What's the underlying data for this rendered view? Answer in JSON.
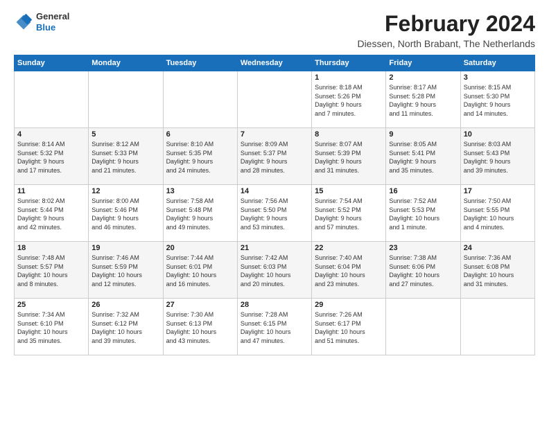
{
  "header": {
    "logo_general": "General",
    "logo_blue": "Blue",
    "month_title": "February 2024",
    "location": "Diessen, North Brabant, The Netherlands"
  },
  "days_of_week": [
    "Sunday",
    "Monday",
    "Tuesday",
    "Wednesday",
    "Thursday",
    "Friday",
    "Saturday"
  ],
  "weeks": [
    [
      {
        "day": "",
        "info": ""
      },
      {
        "day": "",
        "info": ""
      },
      {
        "day": "",
        "info": ""
      },
      {
        "day": "",
        "info": ""
      },
      {
        "day": "1",
        "info": "Sunrise: 8:18 AM\nSunset: 5:26 PM\nDaylight: 9 hours\nand 7 minutes."
      },
      {
        "day": "2",
        "info": "Sunrise: 8:17 AM\nSunset: 5:28 PM\nDaylight: 9 hours\nand 11 minutes."
      },
      {
        "day": "3",
        "info": "Sunrise: 8:15 AM\nSunset: 5:30 PM\nDaylight: 9 hours\nand 14 minutes."
      }
    ],
    [
      {
        "day": "4",
        "info": "Sunrise: 8:14 AM\nSunset: 5:32 PM\nDaylight: 9 hours\nand 17 minutes."
      },
      {
        "day": "5",
        "info": "Sunrise: 8:12 AM\nSunset: 5:33 PM\nDaylight: 9 hours\nand 21 minutes."
      },
      {
        "day": "6",
        "info": "Sunrise: 8:10 AM\nSunset: 5:35 PM\nDaylight: 9 hours\nand 24 minutes."
      },
      {
        "day": "7",
        "info": "Sunrise: 8:09 AM\nSunset: 5:37 PM\nDaylight: 9 hours\nand 28 minutes."
      },
      {
        "day": "8",
        "info": "Sunrise: 8:07 AM\nSunset: 5:39 PM\nDaylight: 9 hours\nand 31 minutes."
      },
      {
        "day": "9",
        "info": "Sunrise: 8:05 AM\nSunset: 5:41 PM\nDaylight: 9 hours\nand 35 minutes."
      },
      {
        "day": "10",
        "info": "Sunrise: 8:03 AM\nSunset: 5:43 PM\nDaylight: 9 hours\nand 39 minutes."
      }
    ],
    [
      {
        "day": "11",
        "info": "Sunrise: 8:02 AM\nSunset: 5:44 PM\nDaylight: 9 hours\nand 42 minutes."
      },
      {
        "day": "12",
        "info": "Sunrise: 8:00 AM\nSunset: 5:46 PM\nDaylight: 9 hours\nand 46 minutes."
      },
      {
        "day": "13",
        "info": "Sunrise: 7:58 AM\nSunset: 5:48 PM\nDaylight: 9 hours\nand 49 minutes."
      },
      {
        "day": "14",
        "info": "Sunrise: 7:56 AM\nSunset: 5:50 PM\nDaylight: 9 hours\nand 53 minutes."
      },
      {
        "day": "15",
        "info": "Sunrise: 7:54 AM\nSunset: 5:52 PM\nDaylight: 9 hours\nand 57 minutes."
      },
      {
        "day": "16",
        "info": "Sunrise: 7:52 AM\nSunset: 5:53 PM\nDaylight: 10 hours\nand 1 minute."
      },
      {
        "day": "17",
        "info": "Sunrise: 7:50 AM\nSunset: 5:55 PM\nDaylight: 10 hours\nand 4 minutes."
      }
    ],
    [
      {
        "day": "18",
        "info": "Sunrise: 7:48 AM\nSunset: 5:57 PM\nDaylight: 10 hours\nand 8 minutes."
      },
      {
        "day": "19",
        "info": "Sunrise: 7:46 AM\nSunset: 5:59 PM\nDaylight: 10 hours\nand 12 minutes."
      },
      {
        "day": "20",
        "info": "Sunrise: 7:44 AM\nSunset: 6:01 PM\nDaylight: 10 hours\nand 16 minutes."
      },
      {
        "day": "21",
        "info": "Sunrise: 7:42 AM\nSunset: 6:03 PM\nDaylight: 10 hours\nand 20 minutes."
      },
      {
        "day": "22",
        "info": "Sunrise: 7:40 AM\nSunset: 6:04 PM\nDaylight: 10 hours\nand 23 minutes."
      },
      {
        "day": "23",
        "info": "Sunrise: 7:38 AM\nSunset: 6:06 PM\nDaylight: 10 hours\nand 27 minutes."
      },
      {
        "day": "24",
        "info": "Sunrise: 7:36 AM\nSunset: 6:08 PM\nDaylight: 10 hours\nand 31 minutes."
      }
    ],
    [
      {
        "day": "25",
        "info": "Sunrise: 7:34 AM\nSunset: 6:10 PM\nDaylight: 10 hours\nand 35 minutes."
      },
      {
        "day": "26",
        "info": "Sunrise: 7:32 AM\nSunset: 6:12 PM\nDaylight: 10 hours\nand 39 minutes."
      },
      {
        "day": "27",
        "info": "Sunrise: 7:30 AM\nSunset: 6:13 PM\nDaylight: 10 hours\nand 43 minutes."
      },
      {
        "day": "28",
        "info": "Sunrise: 7:28 AM\nSunset: 6:15 PM\nDaylight: 10 hours\nand 47 minutes."
      },
      {
        "day": "29",
        "info": "Sunrise: 7:26 AM\nSunset: 6:17 PM\nDaylight: 10 hours\nand 51 minutes."
      },
      {
        "day": "",
        "info": ""
      },
      {
        "day": "",
        "info": ""
      }
    ]
  ]
}
